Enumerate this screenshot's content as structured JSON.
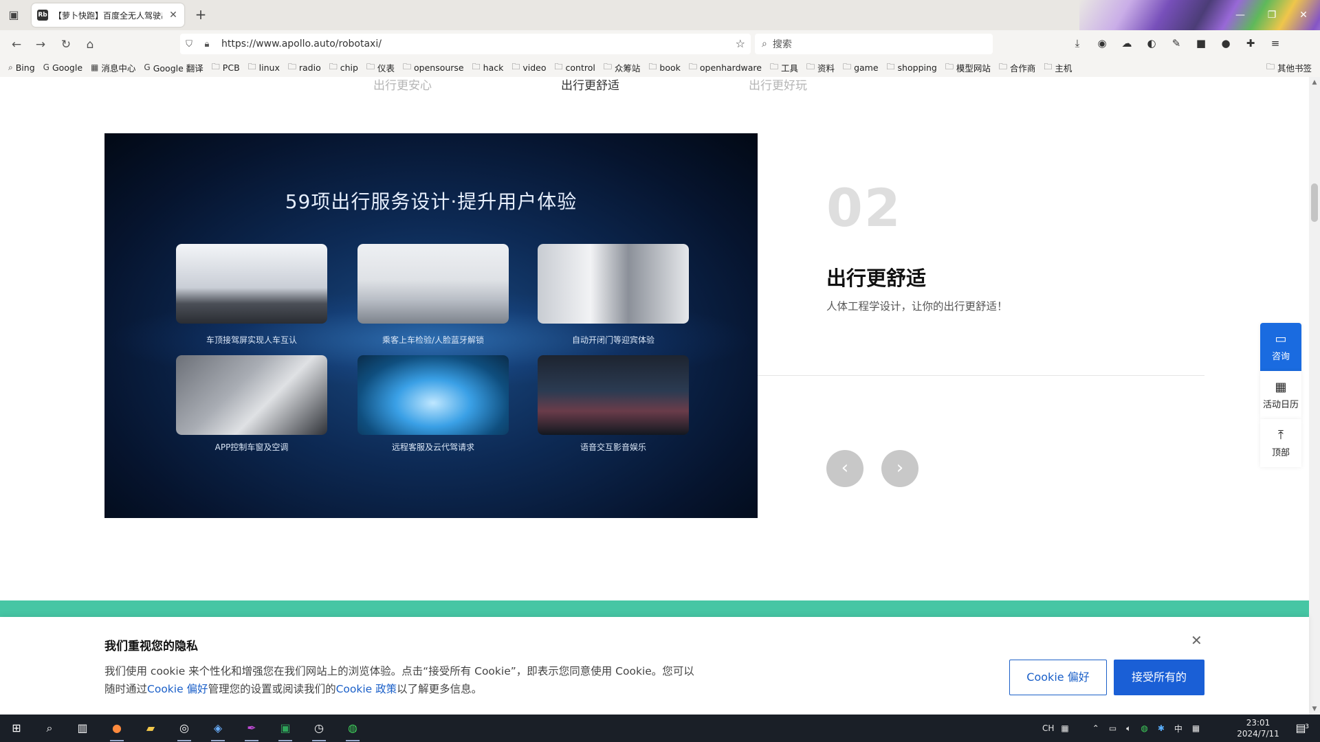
{
  "browser": {
    "tab_title": "【萝卜快跑】百度全无人驾驶出",
    "tab_favicon": "Rb",
    "url": "https://www.apollo.auto/robotaxi/",
    "search_placeholder": "搜索",
    "bookmarks": [
      "Bing",
      "Google",
      "消息中心",
      "Google 翻译",
      "PCB",
      "linux",
      "radio",
      "chip",
      "仪表",
      "opensourse",
      "hack",
      "video",
      "control",
      "众筹站",
      "book",
      "openhardware",
      "工具",
      "资料",
      "game",
      "shopping",
      "模型网站",
      "合作商",
      "主机"
    ],
    "bookmarks_other": "其他书签"
  },
  "page": {
    "subtabs": [
      "出行更安心",
      "出行更舒适",
      "出行更好玩"
    ],
    "active_subtab": 1,
    "banner": {
      "title": "59项出行服务设计·提升用户体验",
      "cards": [
        {
          "caption": "车顶接驾屏实现人车互认"
        },
        {
          "caption": "乘客上车检验/人脸蓝牙解锁"
        },
        {
          "caption": "自动开闭门等迎宾体验"
        },
        {
          "caption": "APP控制车窗及空调"
        },
        {
          "caption": "远程客服及云代驾请求"
        },
        {
          "caption": "语音交互影音娱乐"
        }
      ]
    },
    "section": {
      "number": "02",
      "title": "出行更舒适",
      "desc": "人体工程学设计，让你的出行更舒适！"
    },
    "side_float": {
      "consult": "咨询",
      "calendar": "活动日历",
      "top": "顶部"
    }
  },
  "cookie": {
    "title": "我们重视您的隐私",
    "text_1": "我们使用 cookie 来个性化和增强您在我们网站上的浏览体验。点击“接受所有 Cookie”，即表示您同意使用 Cookie。您可以",
    "text_2a": "随时通过",
    "link_pref": "Cookie 偏好",
    "text_2b": "管理您的设置或阅读我们的",
    "link_policy": "Cookie 政策",
    "text_2c": "以了解更多信息。",
    "btn_pref": "Cookie 偏好",
    "btn_accept": "接受所有的"
  },
  "taskbar": {
    "ime": "CH",
    "lang": "中",
    "time": "23:01",
    "date": "2024/7/11",
    "notification_count": "3"
  }
}
